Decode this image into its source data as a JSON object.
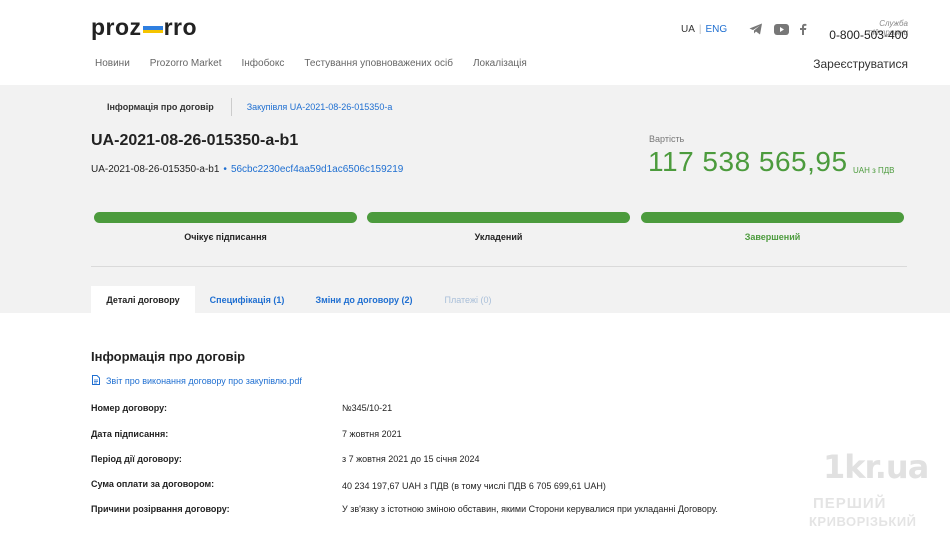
{
  "header": {
    "logo_left": "proz",
    "logo_right": "rro",
    "lang_ua": "UA",
    "lang_sep": "|",
    "lang_eng": "ENG",
    "support_label": "Служба підтримки",
    "support_phone": "0-800-503-400",
    "register": "Зареєструватися",
    "nav": [
      "Новини",
      "Prozorro Market",
      "Інфобокс",
      "Тестування уповноважених осіб",
      "Локалізація"
    ]
  },
  "breadcrumb": {
    "current": "Інформація про договір",
    "link": "Закупівля UA-2021-08-26-015350-a"
  },
  "contract": {
    "title": "UA-2021-08-26-015350-a-b1",
    "id": "UA-2021-08-26-015350-a-b1",
    "dot": "•",
    "hash": "56cbc2230ecf4aa59d1ac6506c159219",
    "value_label": "Вартість",
    "value_amount": "117 538 565,95",
    "value_currency": "UAH з ПДВ"
  },
  "stages": [
    {
      "label": "Очікує підписання",
      "progress": 1.0
    },
    {
      "label": "Укладений",
      "progress": 1.0
    },
    {
      "label": "Завершений",
      "progress": 1.0
    }
  ],
  "tabs": [
    {
      "label": "Деталі договору",
      "state": "active"
    },
    {
      "label": "Специфікація (1)",
      "state": "link"
    },
    {
      "label": "Зміни до договору (2)",
      "state": "link"
    },
    {
      "label": "Платежі (0)",
      "state": "disabled"
    }
  ],
  "details": {
    "section_title": "Інформація про договір",
    "file": "Звіт про виконання договору про закупівлю.pdf",
    "rows": [
      {
        "label": "Номер договору:",
        "value": "№345/10-21"
      },
      {
        "label": "Дата підписання:",
        "value": "7 жовтня 2021"
      },
      {
        "label": "Період дії договору:",
        "value": "з 7 жовтня 2021 до 15 січня 2024"
      },
      {
        "label": "Сума оплати за договором:",
        "value": "40 234 197,67 UAH з ПДВ (в тому числі ПДВ 6 705 699,61 UAH)"
      },
      {
        "label": "Причини розірвання договору:",
        "value": "У зв'язку з істотною зміною обставин, якими Сторони керувалися при укладанні Договору."
      }
    ]
  },
  "watermark": {
    "main": "1kr.ua",
    "line1": "ПЕРШИЙ",
    "line2": "КРИВОРІЗЬКИЙ"
  },
  "colors": {
    "accent_blue": "#1f6fd1",
    "success_green": "#4c9b3d",
    "grey_bg": "#f2f2f2"
  },
  "icons": [
    "telegram-icon",
    "youtube-icon",
    "facebook-icon",
    "document-icon"
  ]
}
